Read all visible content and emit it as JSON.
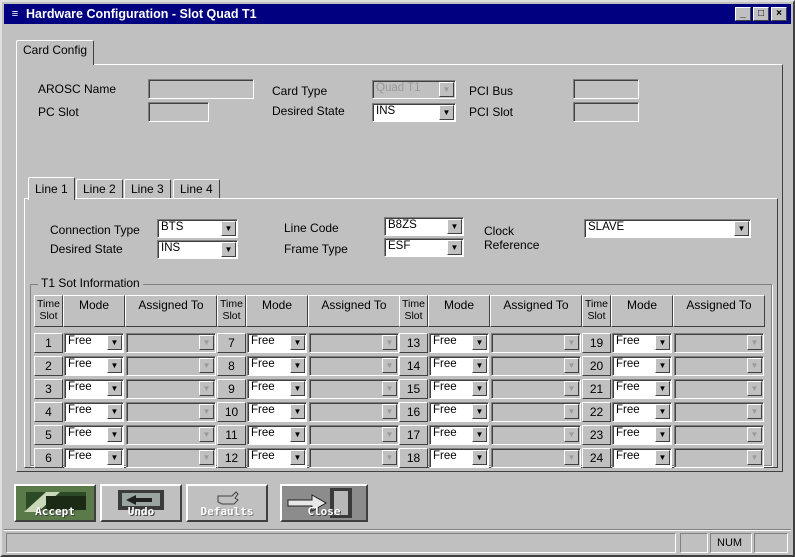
{
  "window": {
    "title": "Hardware Configuration - Slot   Quad T1",
    "minimize": "_",
    "maximize": "□",
    "close": "×"
  },
  "tabs": {
    "card_config": "Card Config"
  },
  "card": {
    "arosc_name_label": "AROSC Name",
    "arosc_name_value": "",
    "pc_slot_label": "PC Slot",
    "pc_slot_value": "",
    "card_type_label": "Card Type",
    "card_type_value": "Quad T1",
    "desired_state_label": "Desired State",
    "desired_state_value": "INS",
    "pci_bus_label": "PCI Bus",
    "pci_bus_value": "",
    "pci_slot_label": "PCI Slot",
    "pci_slot_value": ""
  },
  "line_tabs": [
    "Line 1",
    "Line 2",
    "Line 3",
    "Line 4"
  ],
  "line": {
    "connection_type_label": "Connection Type",
    "connection_type_value": "BTS",
    "desired_state_label": "Desired State",
    "desired_state_value": "INS",
    "line_code_label": "Line Code",
    "line_code_value": "B8ZS",
    "frame_type_label": "Frame Type",
    "frame_type_value": "ESF",
    "clock_reference_label_1": "Clock",
    "clock_reference_label_2": "Reference",
    "clock_reference_value": "SLAVE"
  },
  "t1_group": {
    "title": "T1 Sot Information",
    "headers": {
      "time_slot_1": "Time",
      "time_slot_2": "Slot",
      "mode": "Mode",
      "assigned_to": "Assigned To"
    },
    "columns": [
      {
        "slots": [
          {
            "slot": "1",
            "mode": "Free",
            "assigned": ""
          },
          {
            "slot": "2",
            "mode": "Free",
            "assigned": ""
          },
          {
            "slot": "3",
            "mode": "Free",
            "assigned": ""
          },
          {
            "slot": "4",
            "mode": "Free",
            "assigned": ""
          },
          {
            "slot": "5",
            "mode": "Free",
            "assigned": ""
          },
          {
            "slot": "6",
            "mode": "Free",
            "assigned": ""
          }
        ]
      },
      {
        "slots": [
          {
            "slot": "7",
            "mode": "Free",
            "assigned": ""
          },
          {
            "slot": "8",
            "mode": "Free",
            "assigned": ""
          },
          {
            "slot": "9",
            "mode": "Free",
            "assigned": ""
          },
          {
            "slot": "10",
            "mode": "Free",
            "assigned": ""
          },
          {
            "slot": "11",
            "mode": "Free",
            "assigned": ""
          },
          {
            "slot": "12",
            "mode": "Free",
            "assigned": ""
          }
        ]
      },
      {
        "slots": [
          {
            "slot": "13",
            "mode": "Free",
            "assigned": ""
          },
          {
            "slot": "14",
            "mode": "Free",
            "assigned": ""
          },
          {
            "slot": "15",
            "mode": "Free",
            "assigned": ""
          },
          {
            "slot": "16",
            "mode": "Free",
            "assigned": ""
          },
          {
            "slot": "17",
            "mode": "Free",
            "assigned": ""
          },
          {
            "slot": "18",
            "mode": "Free",
            "assigned": ""
          }
        ]
      },
      {
        "slots": [
          {
            "slot": "19",
            "mode": "Free",
            "assigned": ""
          },
          {
            "slot": "20",
            "mode": "Free",
            "assigned": ""
          },
          {
            "slot": "21",
            "mode": "Free",
            "assigned": ""
          },
          {
            "slot": "22",
            "mode": "Free",
            "assigned": ""
          },
          {
            "slot": "23",
            "mode": "Free",
            "assigned": ""
          },
          {
            "slot": "24",
            "mode": "Free",
            "assigned": ""
          }
        ]
      }
    ]
  },
  "toolbar": {
    "accept": "Accept",
    "undo": "Undo",
    "defaults": "Defaults",
    "close": "Close"
  },
  "status": {
    "num": "NUM"
  },
  "colors": {
    "titlebar": "#000080",
    "face": "#c0c0c0"
  }
}
